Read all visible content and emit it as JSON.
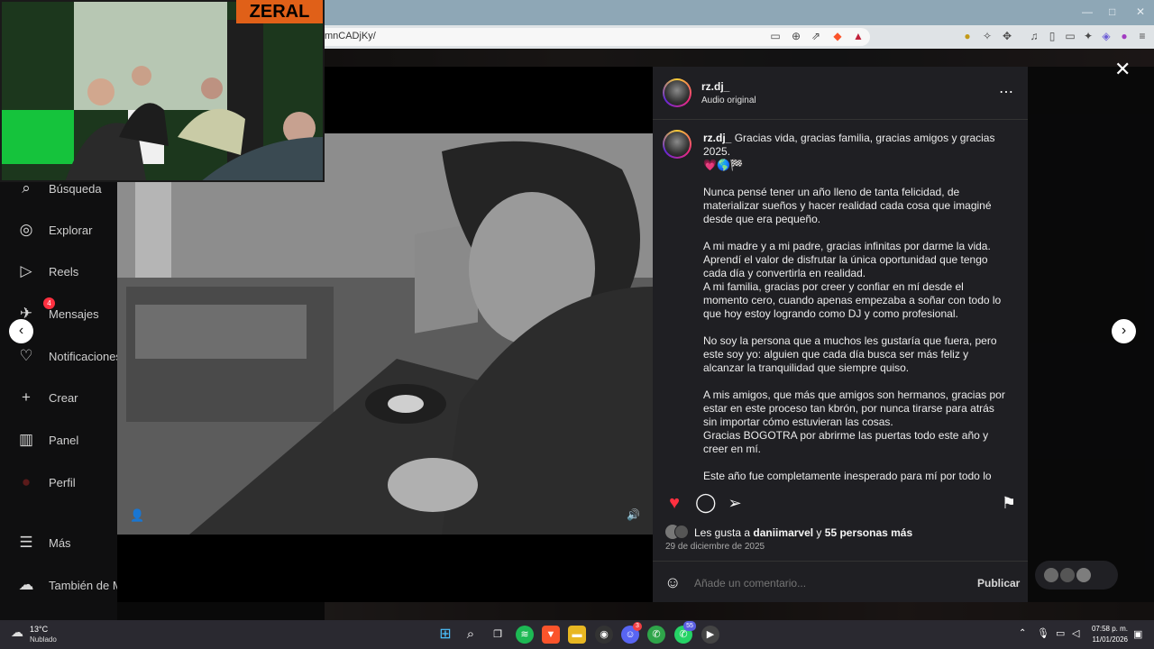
{
  "browser": {
    "url": "mnCADjKy/",
    "toolbar_icons": [
      "install-icon",
      "zoom-icon",
      "share-icon",
      "brave-shield-icon",
      "brave-rewards-icon"
    ],
    "ext_icons": [
      "extension-1",
      "extension-2",
      "extension-3",
      "music-icon",
      "reading-list-icon",
      "bookmarks-icon",
      "wallet-icon",
      "vpn-icon",
      "leo-icon",
      "menu-icon"
    ]
  },
  "overlay_badge": "ZERAL",
  "sidebar": {
    "items": [
      {
        "label": "Búsqueda",
        "icon": "search-icon",
        "glyph": "⌕"
      },
      {
        "label": "Explorar",
        "icon": "compass-icon",
        "glyph": "◎"
      },
      {
        "label": "Reels",
        "icon": "reels-icon",
        "glyph": "▷"
      },
      {
        "label": "Mensajes",
        "icon": "messages-icon",
        "glyph": "✈",
        "badge": "4"
      },
      {
        "label": "Notificaciones",
        "icon": "heart-icon",
        "glyph": "♡"
      },
      {
        "label": "Crear",
        "icon": "plus-icon",
        "glyph": "+"
      },
      {
        "label": "Panel",
        "icon": "dashboard-icon",
        "glyph": "▥"
      },
      {
        "label": "Perfil",
        "icon": "profile-icon",
        "glyph": "●"
      },
      {
        "label": "Más",
        "icon": "hamburger-icon",
        "glyph": "☰"
      },
      {
        "label": "También de Meta",
        "icon": "meta-icon",
        "glyph": "⋯"
      }
    ]
  },
  "post": {
    "username": "rz.dj_",
    "audio": "Audio original",
    "caption_first": "Gracias vida, gracias familia, gracias amigos y gracias 2025.",
    "caption_emoji": "💗🌎🏁",
    "paragraphs": [
      "Nunca pensé tener un año lleno de tanta felicidad, de materializar sueños y hacer realidad cada cosa que imaginé desde que era pequeño.",
      "A mi madre y a mi padre, gracias infinitas por darme la vida. Aprendí el valor de disfrutar la única oportunidad que tengo cada día y convertirla en realidad.\nA mi familia, gracias por creer y confiar en mí desde el momento cero, cuando apenas empezaba a soñar con todo lo que hoy estoy logrando como DJ y como profesional.",
      "No soy la persona que a muchos les gustaría que fuera, pero este soy yo: alguien que cada día busca ser más feliz y alcanzar la tranquilidad que siempre quiso.",
      "A mis amigos, que más que amigos son hermanos, gracias por estar en este proceso tan kbrón, por nunca tirarse para atrás sin importar cómo estuvieran las cosas.\nGracias BOGOTRA por abrirme las puertas todo este año y creer en mí.",
      "Este año fue completamente inesperado para mí por todo lo que pasó. Gracias siempre a la música, por ser ese arte que conecta,"
    ],
    "likes_prefix": "Les gusta a ",
    "likes_user": "daniimarvel",
    "likes_mid": " y ",
    "likes_count": "55 personas más",
    "date": "29 de diciembre de 2025",
    "comment_placeholder": "Añade un comentario...",
    "publish": "Publicar",
    "liked": true
  },
  "taskbar": {
    "weather_temp": "13°C",
    "weather_desc": "Nublado",
    "time": "07:58 p. m.",
    "date": "11/01/2026",
    "app_badges": {
      "discord": "3",
      "whatsapp": "55"
    }
  }
}
